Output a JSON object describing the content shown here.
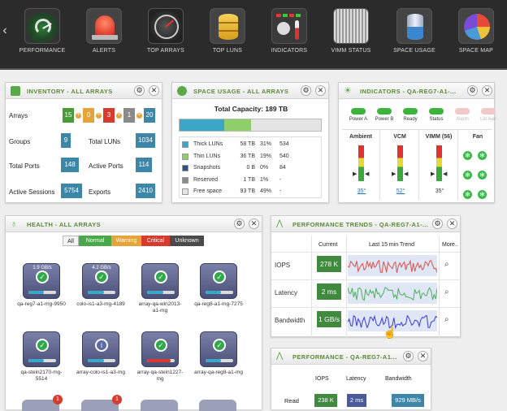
{
  "nav": {
    "items": [
      {
        "label": "PERFORMANCE",
        "icon": "performance-gauge-icon"
      },
      {
        "label": "ALERTS",
        "icon": "alert-siren-icon"
      },
      {
        "label": "TOP ARRAYS",
        "icon": "speedometer-icon"
      },
      {
        "label": "TOP LUNS",
        "icon": "database-stack-icon"
      },
      {
        "label": "INDICATORS",
        "icon": "indicators-panel-icon"
      },
      {
        "label": "VIMM STATUS",
        "icon": "server-rack-icon"
      },
      {
        "label": "SPACE USAGE",
        "icon": "storage-cylinder-icon"
      },
      {
        "label": "SPACE MAP",
        "icon": "pie-map-icon"
      }
    ]
  },
  "inventory": {
    "title": "INVENTORY - ALL ARRAYS",
    "arrays_label": "Arrays",
    "arrays_counts": [
      "15",
      "0",
      "3",
      "1"
    ],
    "arrays_total": "20",
    "groups_label": "Groups",
    "groups": "9",
    "total_luns_label": "Total LUNs",
    "total_luns": "1034",
    "total_ports_label": "Total Ports",
    "total_ports": "148",
    "active_ports_label": "Active Ports",
    "active_ports": "114",
    "active_sessions_label": "Active Sessions",
    "active_sessions": "5754",
    "exports_label": "Exports",
    "exports": "2410"
  },
  "space": {
    "title": "SPACE USAGE - ALL ARRAYS",
    "capacity": "Total Capacity: 189 TB",
    "bar": {
      "thick": 0.31,
      "thin": 0.19
    },
    "rows": [
      {
        "name": "Thick LUNs",
        "size": "58 TB",
        "pct": "31%",
        "count": "534",
        "color": "#3aa7c9"
      },
      {
        "name": "Thin LUNs",
        "size": "36 TB",
        "pct": "19%",
        "count": "540",
        "color": "#8fcf6a"
      },
      {
        "name": "Snapshots",
        "size": "0 B",
        "pct": "0%",
        "count": "84",
        "color": "#2f4f86"
      },
      {
        "name": "Reserved",
        "size": "1 TB",
        "pct": "1%",
        "count": "-",
        "color": "#8a8a8a"
      },
      {
        "name": "Free space",
        "size": "93 TB",
        "pct": "49%",
        "count": "-",
        "color": "#e4e4e4"
      }
    ]
  },
  "indicators": {
    "title": "INDICATORS - QA-REG7-A1-...",
    "leds": [
      {
        "label": "Power A",
        "color": "#3cb33c"
      },
      {
        "label": "Power B",
        "color": "#3cb33c"
      },
      {
        "label": "Ready",
        "color": "#3cb33c"
      },
      {
        "label": "Status",
        "color": "#3cb33c"
      },
      {
        "label": "Alarm",
        "color": "#f2c9c9"
      },
      {
        "label": "Lid Ajar",
        "color": "#f2c9c9"
      }
    ],
    "columns": [
      "Ambient",
      "VCM",
      "VIMM (56)",
      "Fan"
    ],
    "temps": [
      "35°",
      "52°",
      "35°"
    ]
  },
  "health": {
    "title": "HEALTH - ALL ARRAYS",
    "filters": [
      "All",
      "Normal",
      "Warning",
      "Critical",
      "Unknown"
    ],
    "devices": [
      {
        "name": "qa-reg7-a1-mg-9950",
        "rate": "1.9 GB/s",
        "status": "ok",
        "bar": 0.55,
        "barColor": "#3aa7c9"
      },
      {
        "name": "colo-is1-a3-mg-4189",
        "rate": "4.2 GB/s",
        "status": "ok",
        "bar": 0.6,
        "barColor": "#3aa7c9"
      },
      {
        "name": "array-qa-win2013-a1-mg",
        "rate": "",
        "status": "ok",
        "bar": 0.6,
        "barColor": "#3aa7c9"
      },
      {
        "name": "qa-reg8-a1-mg-7275",
        "rate": "",
        "status": "ok",
        "bar": 0.55,
        "barColor": "#3aa7c9"
      },
      {
        "name": "qa-stein2170-mg-5514",
        "rate": "",
        "status": "ok",
        "bar": 0.55,
        "barColor": "#3aa7c9"
      },
      {
        "name": "array-colo-is1-a3-mg",
        "rate": "",
        "status": "info",
        "bar": 0.6,
        "barColor": "#3aa7c9"
      },
      {
        "name": "array-qa-stein1227-mg",
        "rate": "",
        "status": "ok",
        "bar": 0.85,
        "barColor": "#d93a2e"
      },
      {
        "name": "array-qa-reg8-a1-mg",
        "rate": "",
        "status": "ok",
        "bar": 0.55,
        "barColor": "#3aa7c9"
      }
    ],
    "badges": [
      "1",
      "1"
    ]
  },
  "trends": {
    "title": "PERFORMANCE TRENDS - QA-REG7-A1-...",
    "col_current": "Current",
    "col_trend": "Last 15 min Trend",
    "col_more": "More..",
    "rows": [
      {
        "label": "IOPS",
        "value": "278 K",
        "color": "#e0504a"
      },
      {
        "label": "Latency",
        "value": "2 ms",
        "color": "#4fae5a"
      },
      {
        "label": "Bandwidth",
        "value": "1 GB/s",
        "color": "#3a3ae0"
      }
    ]
  },
  "perf": {
    "title": "PERFORMANCE - QA-REG7-A1...",
    "cols": [
      "IOPS",
      "Latency",
      "Bandwidth"
    ],
    "row_label": "Read",
    "values": [
      "238 K",
      "2 ms",
      "929 MB/s"
    ]
  }
}
